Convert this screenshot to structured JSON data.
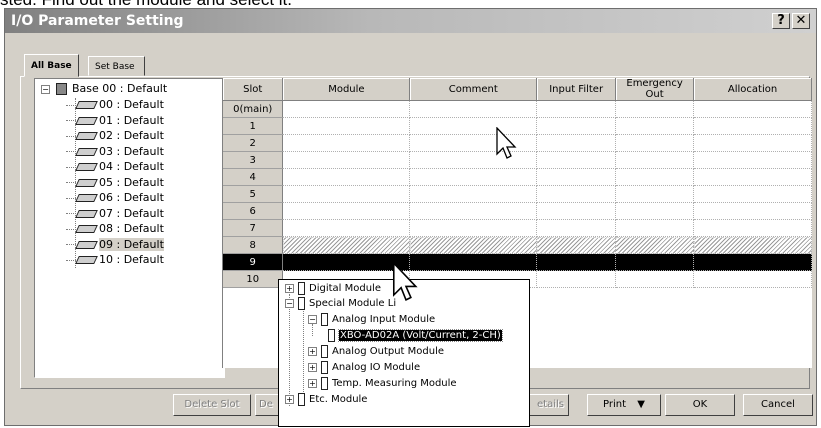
{
  "caption": "sted. Find out the module and select it.",
  "window": {
    "title": "I/O Parameter Setting",
    "help": "?",
    "close": "✕"
  },
  "tabs": {
    "all_base": "All Base",
    "set_base": "Set Base"
  },
  "tree": {
    "root": "Base 00 : Default",
    "items": [
      "00 : Default",
      "01 : Default",
      "02 : Default",
      "03 : Default",
      "04 : Default",
      "05 : Default",
      "06 : Default",
      "07 : Default",
      "08 : Default",
      "09 : Default",
      "10 : Default"
    ],
    "selected_index": 9
  },
  "grid": {
    "columns": [
      "Slot",
      "Module",
      "Comment",
      "Input Filter",
      "Emergency Out",
      "Allocation"
    ],
    "slots": [
      "0(main)",
      "1",
      "2",
      "3",
      "4",
      "5",
      "6",
      "7",
      "8",
      "9",
      "10"
    ],
    "hatched_slot": "8",
    "active_slot": "9"
  },
  "dropdown": {
    "items": [
      {
        "label": "Digital Module",
        "expander": "+"
      },
      {
        "label": "Special Module Li",
        "expander": "−"
      },
      {
        "label": "Analog Input Module",
        "expander": "−"
      },
      {
        "label": "XBO-AD02A (Volt/Current, 2-CH)",
        "expander": ""
      },
      {
        "label": "Analog Output Module",
        "expander": "+"
      },
      {
        "label": "Analog IO Module",
        "expander": "+"
      },
      {
        "label": "Temp. Measuring Module",
        "expander": "+"
      },
      {
        "label": "Etc. Module",
        "expander": "+"
      }
    ],
    "selected": "XBO-AD02A (Volt/Current, 2-CH)"
  },
  "buttons": {
    "delete_slot": "Delete Slot",
    "de": "De",
    "details": "etails",
    "print": "Print",
    "print_arrow": "▼",
    "ok": "OK",
    "cancel": "Cancel"
  },
  "icons": {
    "expand": "expand-icon",
    "collapse": "collapse-icon",
    "rack": "rack-icon",
    "module": "module-icon",
    "cursor": "mouse-cursor-icon"
  }
}
